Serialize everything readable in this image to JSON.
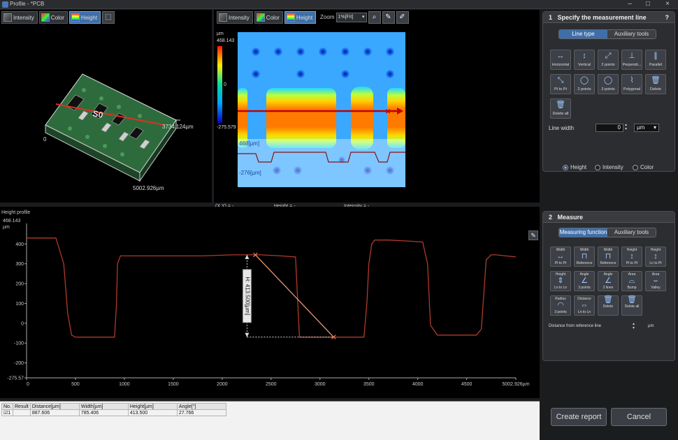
{
  "window": {
    "title": "Profile - *PCB",
    "minimize": "–",
    "maximize": "□",
    "close": "×"
  },
  "view_toolbar_left": {
    "intensity": "Intensity",
    "color": "Color",
    "height": "Height"
  },
  "view_toolbar_center": {
    "intensity": "Intensity",
    "color": "Color",
    "height": "Height",
    "zoom_label": "Zoom",
    "zoom_value": "1%[Fit]"
  },
  "view3d": {
    "y_dim": "3734.124µm",
    "x_dim": "5002.926µm",
    "origin": "0"
  },
  "heightmap": {
    "unit": "µm",
    "scale_max": "468.143",
    "scale_mid": "0",
    "scale_min": "-275.579",
    "top_label": "468[µm]",
    "bottom_label": "-276[µm]"
  },
  "status_bar": {
    "xy": "(X,Y) =  -",
    "height": "Height  =  -",
    "intensity": "Intensity  =  -"
  },
  "panel1": {
    "step": "1",
    "title": "Specify the measurement line",
    "help": "?",
    "tabs": [
      "Line type",
      "Auxiliary tools"
    ],
    "tools": [
      {
        "label": "Horizontal",
        "icon": "horizontal-line-icon",
        "glyph": "↔"
      },
      {
        "label": "Vertical",
        "icon": "vertical-line-icon",
        "glyph": "↕"
      },
      {
        "label": "2 points",
        "icon": "two-points-icon",
        "glyph": "⤢"
      },
      {
        "label": "Perpendi...",
        "icon": "perpendicular-icon",
        "glyph": "⊥"
      },
      {
        "label": "Parallel",
        "icon": "parallel-icon",
        "glyph": "∥"
      },
      {
        "label": "Pt to Pt",
        "icon": "pt-to-pt-icon",
        "glyph": "⤡"
      },
      {
        "label": "2 points",
        "icon": "circle-two-points-icon",
        "glyph": "◯"
      },
      {
        "label": "3 points",
        "icon": "circle-three-points-icon",
        "glyph": "◯"
      },
      {
        "label": "Polygonal",
        "icon": "polygonal-icon",
        "glyph": "⌇"
      },
      {
        "label": "Delete",
        "icon": "delete-icon",
        "glyph": "🗑"
      },
      {
        "label": "Delete all",
        "icon": "delete-all-icon",
        "glyph": "🗑"
      }
    ],
    "line_width_label": "Line width",
    "line_width_value": "0",
    "line_width_unit": "µm",
    "modes": [
      "Height",
      "Intensity",
      "Color"
    ]
  },
  "panel2": {
    "step": "2",
    "title": "Measure",
    "tabs": [
      "Measuring function",
      "Auxiliary tools"
    ],
    "tools": [
      {
        "label": "Pt to Pt",
        "top": "Width",
        "icon": "width-pt-to-pt-icon",
        "glyph": "↔"
      },
      {
        "label": "Reference",
        "top": "Width",
        "icon": "width-reference-icon",
        "glyph": "⊓"
      },
      {
        "label": "Reference",
        "top": "Width",
        "icon": "width-reference2-icon",
        "glyph": "⊓"
      },
      {
        "label": "Pt to Pt",
        "top": "Height",
        "icon": "height-pt-to-pt-icon",
        "glyph": "↕"
      },
      {
        "label": "Ln to Pt",
        "top": "Height",
        "icon": "height-ln-to-pt-icon",
        "glyph": "↕"
      },
      {
        "label": "Ln to Ln",
        "top": "Height",
        "icon": "height-ln-to-ln-icon",
        "glyph": "⇕"
      },
      {
        "label": "3 points",
        "top": "Angle",
        "icon": "angle-3-points-icon",
        "glyph": "∠"
      },
      {
        "label": "2 lines",
        "top": "Angle",
        "icon": "angle-2-lines-icon",
        "glyph": "∠"
      },
      {
        "label": "Bump",
        "top": "Area",
        "icon": "area-bump-icon",
        "glyph": "⌓"
      },
      {
        "label": "Valley",
        "top": "Area",
        "icon": "area-valley-icon",
        "glyph": "⌣"
      },
      {
        "label": "3 points",
        "top": "Radius",
        "icon": "radius-icon",
        "glyph": "◠"
      },
      {
        "label": "Ln to Ln",
        "top": "Distance",
        "icon": "distance-icon",
        "glyph": "⇔"
      },
      {
        "label": "Delete",
        "top": "",
        "icon": "delete-icon",
        "glyph": "🗑"
      },
      {
        "label": "Delete all",
        "top": "",
        "icon": "delete-all-icon",
        "glyph": "🗑"
      }
    ],
    "ref_line_label": "Distance from reference line",
    "ref_line_unit": "µm"
  },
  "profile": {
    "title": "Height profile",
    "y_top_label": "468.143",
    "y_unit": "µm",
    "measurement_label": "H: 413.500[µm]"
  },
  "chart_data": {
    "type": "line",
    "title": "Height profile",
    "xlabel": "",
    "ylabel": "µm",
    "xlim": [
      0,
      5002.926
    ],
    "ylim": [
      -275.579,
      468.143
    ],
    "xticks": [
      "0",
      "500",
      "1000",
      "1500",
      "2000",
      "2500",
      "3000",
      "3500",
      "4000",
      "4500",
      "5002.926µm"
    ],
    "xtick_values": [
      0,
      500,
      1000,
      1500,
      2000,
      2500,
      3000,
      3500,
      4000,
      4500,
      5002.926
    ],
    "yticks": [
      "400",
      "300",
      "200",
      "100",
      "0",
      "-100",
      "-200",
      "-275.57"
    ],
    "ytick_values": [
      400,
      300,
      200,
      100,
      0,
      -100,
      -200,
      -275.57
    ],
    "series": [
      {
        "x": [
          0,
          300,
          380,
          420,
          460,
          500,
          550,
          700,
          830,
          900,
          920,
          930,
          960,
          1000,
          1200,
          1500,
          1800,
          2100,
          2400,
          2600,
          2750,
          2790,
          2810,
          2830,
          2870,
          3000,
          3050,
          3100,
          3250,
          3350,
          3450,
          3480,
          3500,
          3530,
          3560,
          3700,
          3900,
          4050,
          4100,
          4130,
          4200,
          4500,
          4600,
          4650,
          4700,
          4750,
          4800,
          4900,
          5002
        ],
        "y": [
          430,
          430,
          300,
          50,
          -60,
          -70,
          -70,
          -70,
          -70,
          -70,
          100,
          300,
          340,
          340,
          340,
          340,
          340,
          345,
          345,
          340,
          335,
          -70,
          -70,
          -70,
          -70,
          -70,
          -70,
          -70,
          -70,
          -70,
          -70,
          100,
          300,
          400,
          420,
          420,
          415,
          410,
          300,
          -10,
          -60,
          -60,
          -60,
          -30,
          320,
          345,
          345,
          340,
          335
        ]
      }
    ],
    "annotations": [
      {
        "type": "measurement",
        "from": [
          2340,
          345
        ],
        "to": [
          3140,
          -70
        ],
        "label": "H: 413.500[µm]"
      }
    ],
    "grid": false
  },
  "results": {
    "columns": [
      "No.",
      "Result",
      "Distance[µm]",
      "Width[µm]",
      "Height[µm]",
      "Angle[°]"
    ],
    "rows": [
      [
        "1",
        "",
        "887.606",
        "785.406",
        "413.500",
        "27.766"
      ]
    ]
  },
  "buttons": {
    "create_report": "Create report",
    "cancel": "Cancel"
  }
}
